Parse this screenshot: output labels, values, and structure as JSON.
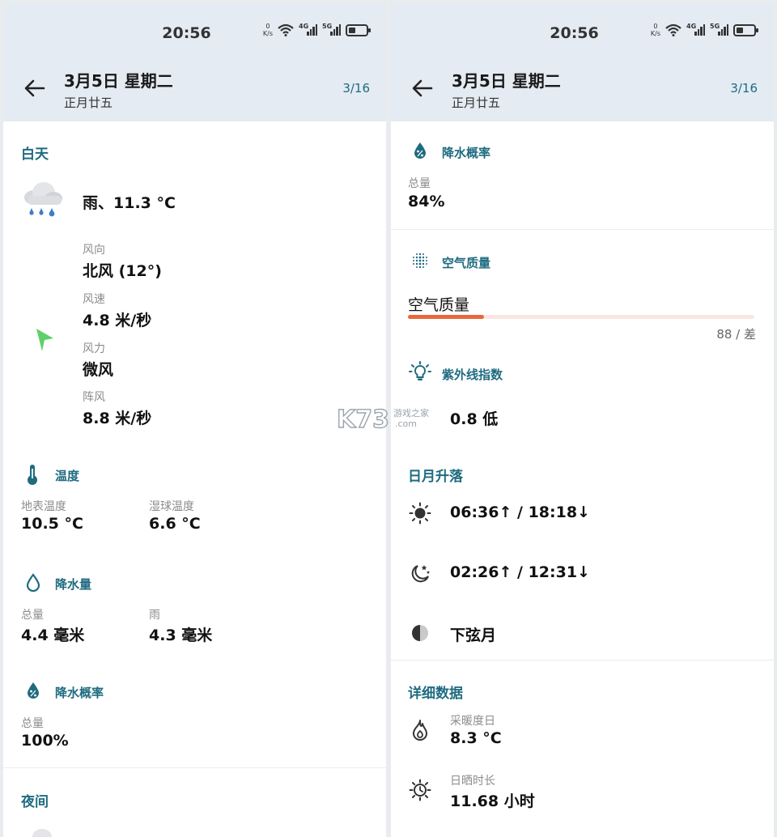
{
  "status": {
    "time": "20:56",
    "netspeed_value": "0",
    "netspeed_unit": "K/s",
    "sig1": "4G",
    "sig2": "5G"
  },
  "header": {
    "date": "3月5日 星期二",
    "lunar": "正月廿五",
    "page": "3/16"
  },
  "left": {
    "day_title": "白天",
    "weather_desc": "雨、11.3 °C",
    "wind": [
      {
        "label": "风向",
        "value": "北风 (12°)"
      },
      {
        "label": "风速",
        "value": "4.8 米/秒"
      },
      {
        "label": "风力",
        "value": "微风"
      },
      {
        "label": "阵风",
        "value": "8.8 米/秒"
      }
    ],
    "temp_title": "温度",
    "temp": [
      {
        "label": "地表温度",
        "value": "10.5 °C"
      },
      {
        "label": "湿球温度",
        "value": "6.6 °C"
      }
    ],
    "precip_title": "降水量",
    "precip": [
      {
        "label": "总量",
        "value": "4.4 毫米"
      },
      {
        "label": "雨",
        "value": "4.3 毫米"
      }
    ],
    "prob_title": "降水概率",
    "prob_label": "总量",
    "prob_value": "100%",
    "night_title": "夜间"
  },
  "right": {
    "prob_title": "降水概率",
    "prob_label": "总量",
    "prob_value": "84%",
    "aq_title": "空气质量",
    "aq_label": "空气质量",
    "aq_reading": "88 / 差",
    "aq_fraction": 0.22,
    "uv_title": "紫外线指数",
    "uv_value": "0.8 低",
    "sunmoon_title": "日月升落",
    "sun_times": "06:36↑ / 18:18↓",
    "moon_times": "02:26↑ / 12:31↓",
    "moon_phase": "下弦月",
    "detail_title": "详细数据",
    "heating_label": "采暖度日",
    "heating_value": "8.3 °C",
    "sunshine_label": "日晒时长",
    "sunshine_value": "11.68 小时"
  },
  "watermark": {
    "text": "K73",
    "sub1": "游戏之家",
    "sub2": ".com"
  },
  "colors": {
    "accent": "#1f6b80",
    "header_bg": "#e4ebf2",
    "aq_bar": "#e8683c",
    "wind_arrow": "#5fcf6a"
  }
}
